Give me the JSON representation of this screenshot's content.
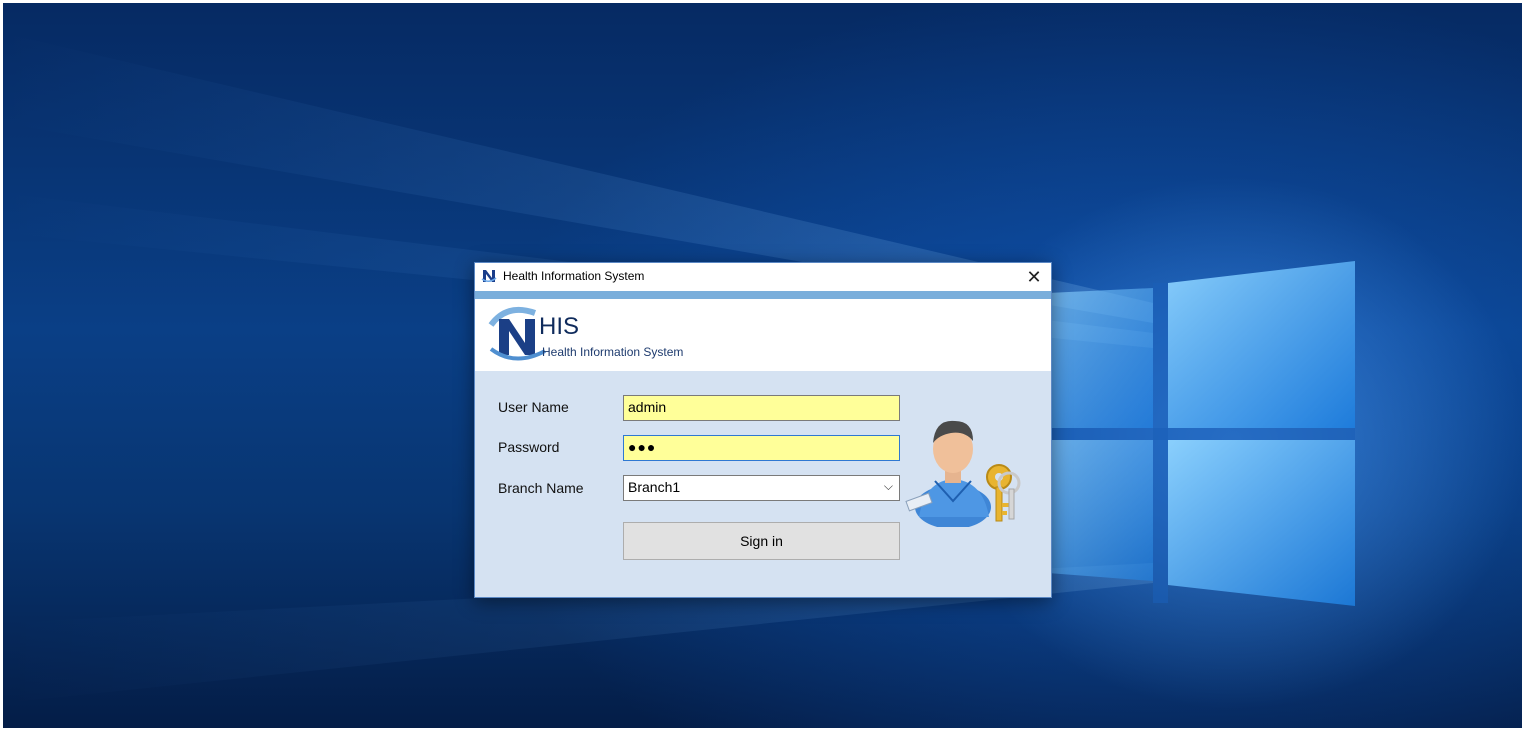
{
  "window": {
    "title": "Health Information System",
    "close_symbol": "✕",
    "icon": "app-logo-icon"
  },
  "banner": {
    "logo_text": "HIS",
    "subtitle": "Health Information System"
  },
  "form": {
    "username_label": "User Name",
    "username_value": "admin",
    "password_label": "Password",
    "password_value": "●●●",
    "branch_label": "Branch Name",
    "branch_value": "Branch1",
    "signin_label": "Sign in"
  },
  "colors": {
    "field_highlight": "#ffff99",
    "dialog_bg": "#d5e2f2",
    "accent_strip": "#7aaedb"
  }
}
